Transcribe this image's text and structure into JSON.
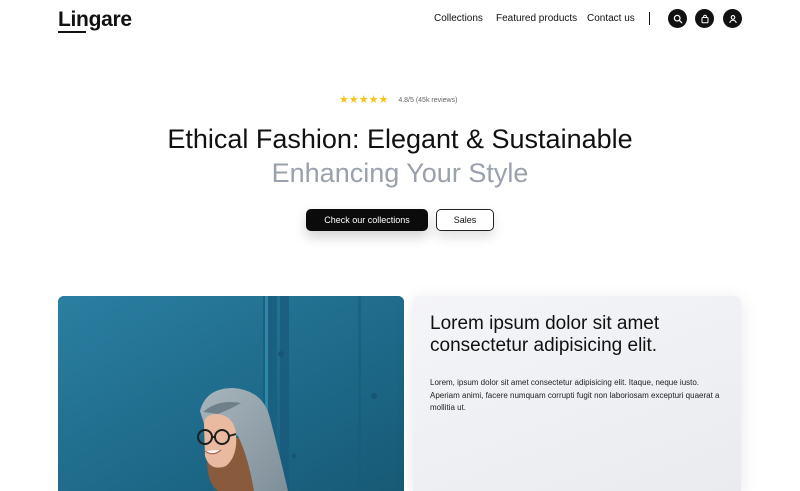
{
  "brand": {
    "name": "Lingare"
  },
  "nav": {
    "links": [
      "Collections",
      "Featured products",
      "Contact us"
    ],
    "icons": [
      "search-icon",
      "bag-icon",
      "user-icon"
    ]
  },
  "hero": {
    "stars": "★★★★★",
    "rating": "4.8/5 (45k reviews)",
    "title": "Ethical Fashion: Elegant & Sustainable",
    "subtitle": "Enhancing Your Style",
    "primary_cta": "Check our collections",
    "secondary_cta": "Sales"
  },
  "feature": {
    "image_label": "Smiling woman wearing glasses and a grey hood against a blue wall",
    "title": "Lorem ipsum dolor sit amet consectetur adipisicing elit.",
    "body": "Lorem, ipsum dolor sit amet consectetur adipisicing elit. Itaque, neque iusto. Aperiam animi, facere numquam corrupti fugit non laboriosam excepturi quaerat a mollitia ut."
  },
  "colors": {
    "accent": "#0b0b0b",
    "subtitle": "#9aa1ac",
    "star": "#f5c518",
    "photo_background": "#1f6b8c"
  }
}
